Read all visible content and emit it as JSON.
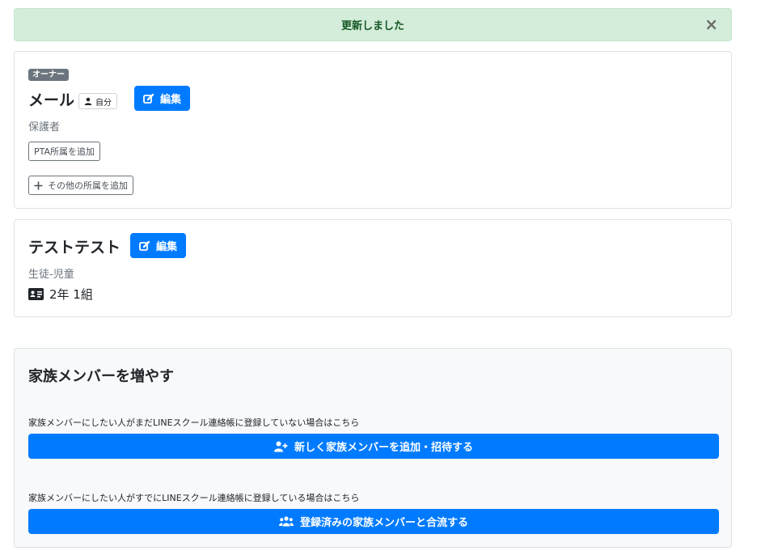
{
  "alert": {
    "message": "更新しました",
    "close": "×"
  },
  "members": [
    {
      "badge": "オーナー",
      "name": "メール",
      "self_label": "自分",
      "edit_label": "編集",
      "role": "保護者",
      "pta_label": "PTA所属を追加",
      "other_label": "その他の所属を追加"
    },
    {
      "name": "テストテスト",
      "edit_label": "編集",
      "role": "生徒-児童",
      "grade": "2年 1組"
    }
  ],
  "family": {
    "title": "家族メンバーを増やす",
    "new_desc": "家族メンバーにしたい人がまだLINEスクール連絡帳に登録していない場合はこちら",
    "new_button": "新しく家族メンバーを追加・招待する",
    "merge_desc": "家族メンバーにしたい人がすでにLINEスクール連絡帳に登録している場合はこちら",
    "merge_button": "登録済みの家族メンバーと合流する"
  },
  "colors": {
    "primary": "#007bff",
    "success_bg": "#d4edda",
    "success_text": "#155724",
    "secondary": "#6c757d"
  },
  "icons": [
    "close-icon",
    "user-icon",
    "edit-icon",
    "plus-icon",
    "id-card-icon",
    "user-plus-icon",
    "users-icon"
  ]
}
